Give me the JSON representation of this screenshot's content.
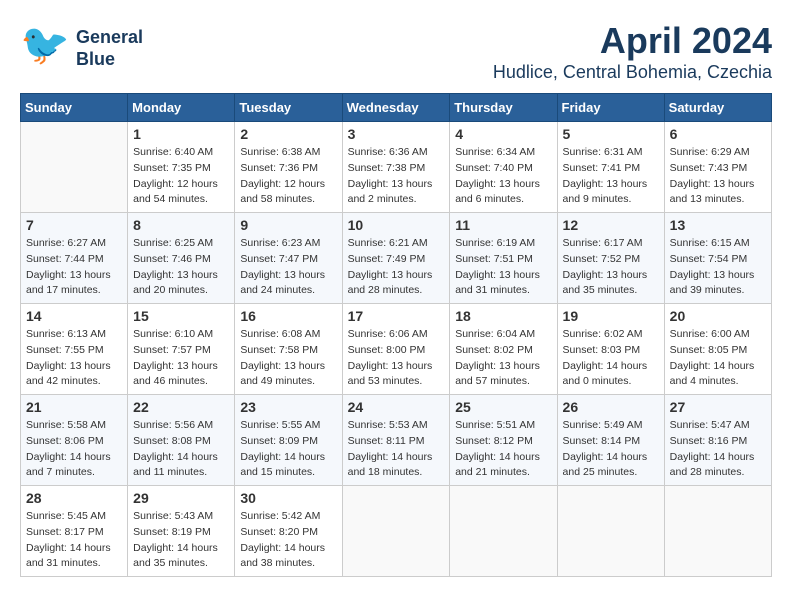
{
  "header": {
    "logo_line1": "General",
    "logo_line2": "Blue",
    "month_year": "April 2024",
    "location": "Hudlice, Central Bohemia, Czechia"
  },
  "days_of_week": [
    "Sunday",
    "Monday",
    "Tuesday",
    "Wednesday",
    "Thursday",
    "Friday",
    "Saturday"
  ],
  "weeks": [
    [
      {
        "day": "",
        "info": ""
      },
      {
        "day": "1",
        "info": "Sunrise: 6:40 AM\nSunset: 7:35 PM\nDaylight: 12 hours\nand 54 minutes."
      },
      {
        "day": "2",
        "info": "Sunrise: 6:38 AM\nSunset: 7:36 PM\nDaylight: 12 hours\nand 58 minutes."
      },
      {
        "day": "3",
        "info": "Sunrise: 6:36 AM\nSunset: 7:38 PM\nDaylight: 13 hours\nand 2 minutes."
      },
      {
        "day": "4",
        "info": "Sunrise: 6:34 AM\nSunset: 7:40 PM\nDaylight: 13 hours\nand 6 minutes."
      },
      {
        "day": "5",
        "info": "Sunrise: 6:31 AM\nSunset: 7:41 PM\nDaylight: 13 hours\nand 9 minutes."
      },
      {
        "day": "6",
        "info": "Sunrise: 6:29 AM\nSunset: 7:43 PM\nDaylight: 13 hours\nand 13 minutes."
      }
    ],
    [
      {
        "day": "7",
        "info": "Sunrise: 6:27 AM\nSunset: 7:44 PM\nDaylight: 13 hours\nand 17 minutes."
      },
      {
        "day": "8",
        "info": "Sunrise: 6:25 AM\nSunset: 7:46 PM\nDaylight: 13 hours\nand 20 minutes."
      },
      {
        "day": "9",
        "info": "Sunrise: 6:23 AM\nSunset: 7:47 PM\nDaylight: 13 hours\nand 24 minutes."
      },
      {
        "day": "10",
        "info": "Sunrise: 6:21 AM\nSunset: 7:49 PM\nDaylight: 13 hours\nand 28 minutes."
      },
      {
        "day": "11",
        "info": "Sunrise: 6:19 AM\nSunset: 7:51 PM\nDaylight: 13 hours\nand 31 minutes."
      },
      {
        "day": "12",
        "info": "Sunrise: 6:17 AM\nSunset: 7:52 PM\nDaylight: 13 hours\nand 35 minutes."
      },
      {
        "day": "13",
        "info": "Sunrise: 6:15 AM\nSunset: 7:54 PM\nDaylight: 13 hours\nand 39 minutes."
      }
    ],
    [
      {
        "day": "14",
        "info": "Sunrise: 6:13 AM\nSunset: 7:55 PM\nDaylight: 13 hours\nand 42 minutes."
      },
      {
        "day": "15",
        "info": "Sunrise: 6:10 AM\nSunset: 7:57 PM\nDaylight: 13 hours\nand 46 minutes."
      },
      {
        "day": "16",
        "info": "Sunrise: 6:08 AM\nSunset: 7:58 PM\nDaylight: 13 hours\nand 49 minutes."
      },
      {
        "day": "17",
        "info": "Sunrise: 6:06 AM\nSunset: 8:00 PM\nDaylight: 13 hours\nand 53 minutes."
      },
      {
        "day": "18",
        "info": "Sunrise: 6:04 AM\nSunset: 8:02 PM\nDaylight: 13 hours\nand 57 minutes."
      },
      {
        "day": "19",
        "info": "Sunrise: 6:02 AM\nSunset: 8:03 PM\nDaylight: 14 hours\nand 0 minutes."
      },
      {
        "day": "20",
        "info": "Sunrise: 6:00 AM\nSunset: 8:05 PM\nDaylight: 14 hours\nand 4 minutes."
      }
    ],
    [
      {
        "day": "21",
        "info": "Sunrise: 5:58 AM\nSunset: 8:06 PM\nDaylight: 14 hours\nand 7 minutes."
      },
      {
        "day": "22",
        "info": "Sunrise: 5:56 AM\nSunset: 8:08 PM\nDaylight: 14 hours\nand 11 minutes."
      },
      {
        "day": "23",
        "info": "Sunrise: 5:55 AM\nSunset: 8:09 PM\nDaylight: 14 hours\nand 15 minutes."
      },
      {
        "day": "24",
        "info": "Sunrise: 5:53 AM\nSunset: 8:11 PM\nDaylight: 14 hours\nand 18 minutes."
      },
      {
        "day": "25",
        "info": "Sunrise: 5:51 AM\nSunset: 8:12 PM\nDaylight: 14 hours\nand 21 minutes."
      },
      {
        "day": "26",
        "info": "Sunrise: 5:49 AM\nSunset: 8:14 PM\nDaylight: 14 hours\nand 25 minutes."
      },
      {
        "day": "27",
        "info": "Sunrise: 5:47 AM\nSunset: 8:16 PM\nDaylight: 14 hours\nand 28 minutes."
      }
    ],
    [
      {
        "day": "28",
        "info": "Sunrise: 5:45 AM\nSunset: 8:17 PM\nDaylight: 14 hours\nand 31 minutes."
      },
      {
        "day": "29",
        "info": "Sunrise: 5:43 AM\nSunset: 8:19 PM\nDaylight: 14 hours\nand 35 minutes."
      },
      {
        "day": "30",
        "info": "Sunrise: 5:42 AM\nSunset: 8:20 PM\nDaylight: 14 hours\nand 38 minutes."
      },
      {
        "day": "",
        "info": ""
      },
      {
        "day": "",
        "info": ""
      },
      {
        "day": "",
        "info": ""
      },
      {
        "day": "",
        "info": ""
      }
    ]
  ]
}
